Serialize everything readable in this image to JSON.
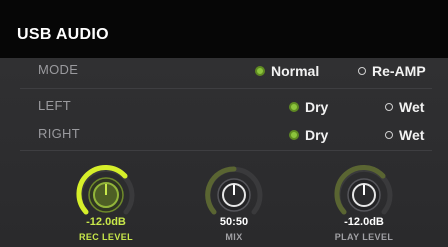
{
  "title": "USB AUDIO",
  "mode": {
    "label": "MODE",
    "options": [
      "Normal",
      "Re-AMP"
    ],
    "selected": "Normal"
  },
  "left": {
    "label": "LEFT",
    "options": [
      "Dry",
      "Wet"
    ],
    "selected": "Dry"
  },
  "right": {
    "label": "RIGHT",
    "options": [
      "Dry",
      "Wet"
    ],
    "selected": "Dry"
  },
  "knobs": [
    {
      "value": "-12.0dB",
      "label": "REC LEVEL",
      "active": true
    },
    {
      "value": "50:50",
      "label": "MIX",
      "active": false
    },
    {
      "value": "-12.0dB",
      "label": "PLAY LEVEL",
      "active": false
    }
  ],
  "colors": {
    "accent": "#8cc43c",
    "highlight": "#c8e84a",
    "background": "#2a2a2c"
  }
}
